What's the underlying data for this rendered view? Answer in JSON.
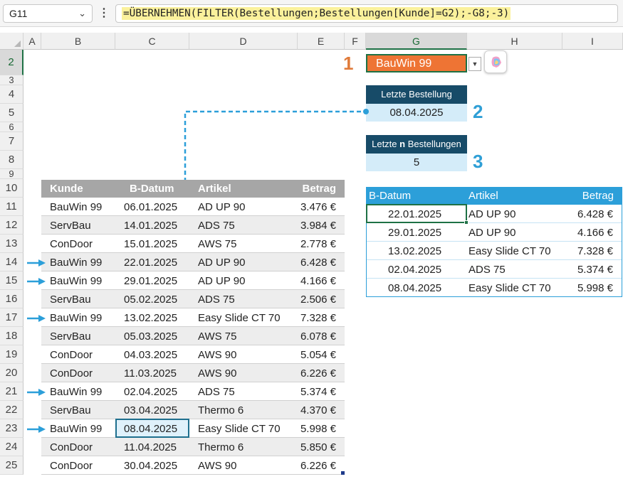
{
  "formula_bar": {
    "name_box": "G11",
    "formula": "=ÜBERNEHMEN(FILTER(Bestellungen;Bestellungen[Kunde]=G2);-G8;-3)"
  },
  "columns": [
    "A",
    "B",
    "C",
    "D",
    "E",
    "F",
    "G",
    "H",
    "I"
  ],
  "rows": [
    "2",
    "3",
    "4",
    "5",
    "6",
    "7",
    "8",
    "9",
    "10",
    "11",
    "12",
    "13",
    "14",
    "15",
    "16",
    "17",
    "18",
    "19",
    "20",
    "21",
    "22",
    "23",
    "24",
    "25"
  ],
  "customer_dropdown": {
    "value": "BauWin 99"
  },
  "markers": {
    "one": "1",
    "two": "2",
    "three": "3"
  },
  "last_order": {
    "header": "Letzte Bestellung",
    "value": "08.04.2025"
  },
  "last_n": {
    "header_pre": "Letzte ",
    "header_bold": "n",
    "header_post": " Bestellungen",
    "value": "5"
  },
  "orders": {
    "headers": [
      "Kunde",
      "B-Datum",
      "Artikel",
      "Betrag"
    ],
    "rows": [
      [
        "BauWin 99",
        "06.01.2025",
        "AD UP 90",
        "3.476 €"
      ],
      [
        "ServBau",
        "14.01.2025",
        "ADS 75",
        "3.984 €"
      ],
      [
        "ConDoor",
        "15.01.2025",
        "AWS 75",
        "2.778 €"
      ],
      [
        "BauWin 99",
        "22.01.2025",
        "AD UP 90",
        "6.428 €"
      ],
      [
        "BauWin 99",
        "29.01.2025",
        "AD UP 90",
        "4.166 €"
      ],
      [
        "ServBau",
        "05.02.2025",
        "ADS 75",
        "2.506 €"
      ],
      [
        "BauWin 99",
        "13.02.2025",
        "Easy Slide CT 70",
        "7.328 €"
      ],
      [
        "ServBau",
        "05.03.2025",
        "AWS 75",
        "6.078 €"
      ],
      [
        "ConDoor",
        "04.03.2025",
        "AWS 90",
        "5.054 €"
      ],
      [
        "ConDoor",
        "11.03.2025",
        "AWS 90",
        "6.226 €"
      ],
      [
        "BauWin 99",
        "02.04.2025",
        "ADS 75",
        "5.374 €"
      ],
      [
        "ServBau",
        "03.04.2025",
        "Thermo 6",
        "4.370 €"
      ],
      [
        "BauWin 99",
        "08.04.2025",
        "Easy Slide CT 70",
        "5.998 €"
      ],
      [
        "ConDoor",
        "11.04.2025",
        "Thermo 6",
        "5.850 €"
      ],
      [
        "ConDoor",
        "30.04.2025",
        "AWS 90",
        "6.226 €"
      ]
    ],
    "arrow_rows": [
      3,
      4,
      6,
      10,
      12
    ]
  },
  "result": {
    "headers": [
      "B-Datum",
      "Artikel",
      "Betrag"
    ],
    "rows": [
      [
        "22.01.2025",
        "AD UP 90",
        "6.428 €"
      ],
      [
        "29.01.2025",
        "AD UP 90",
        "4.166 €"
      ],
      [
        "13.02.2025",
        "Easy Slide CT 70",
        "7.328 €"
      ],
      [
        "02.04.2025",
        "ADS 75",
        "5.374 €"
      ],
      [
        "08.04.2025",
        "Easy Slide CT 70",
        "5.998 €"
      ]
    ]
  },
  "colors": {
    "orange": "#ee7434",
    "navy": "#174b68",
    "light_blue": "#d4ecf9",
    "accent_blue": "#2c9fd9",
    "marker_orange": "#e07b3a",
    "excel_green": "#1e7145"
  }
}
